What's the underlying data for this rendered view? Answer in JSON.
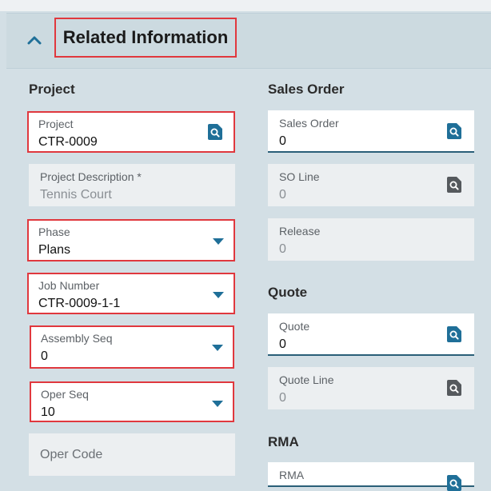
{
  "panel": {
    "title": "Related Information"
  },
  "sections": {
    "project": "Project",
    "sales_order": "Sales Order",
    "quote": "Quote",
    "rma": "RMA"
  },
  "fields": {
    "project": {
      "label": "Project",
      "value": "CTR-0009"
    },
    "project_description": {
      "label": "Project Description *",
      "value": "Tennis Court"
    },
    "phase": {
      "label": "Phase",
      "value": "Plans"
    },
    "job_number": {
      "label": "Job Number",
      "value": "CTR-0009-1-1"
    },
    "assembly_seq": {
      "label": "Assembly Seq",
      "value": "0"
    },
    "oper_seq": {
      "label": "Oper Seq",
      "value": "10"
    },
    "oper_code": {
      "label": "Oper Code"
    },
    "sales_order": {
      "label": "Sales Order",
      "value": "0"
    },
    "so_line": {
      "label": "SO Line",
      "value": "0"
    },
    "release": {
      "label": "Release",
      "value": "0"
    },
    "quote": {
      "label": "Quote",
      "value": "0"
    },
    "quote_line": {
      "label": "Quote Line",
      "value": "0"
    },
    "rma": {
      "label": "RMA"
    }
  },
  "colors": {
    "accent": "#1f6f98",
    "highlight": "#e0383e",
    "panel_bg": "#d3dfe5"
  }
}
